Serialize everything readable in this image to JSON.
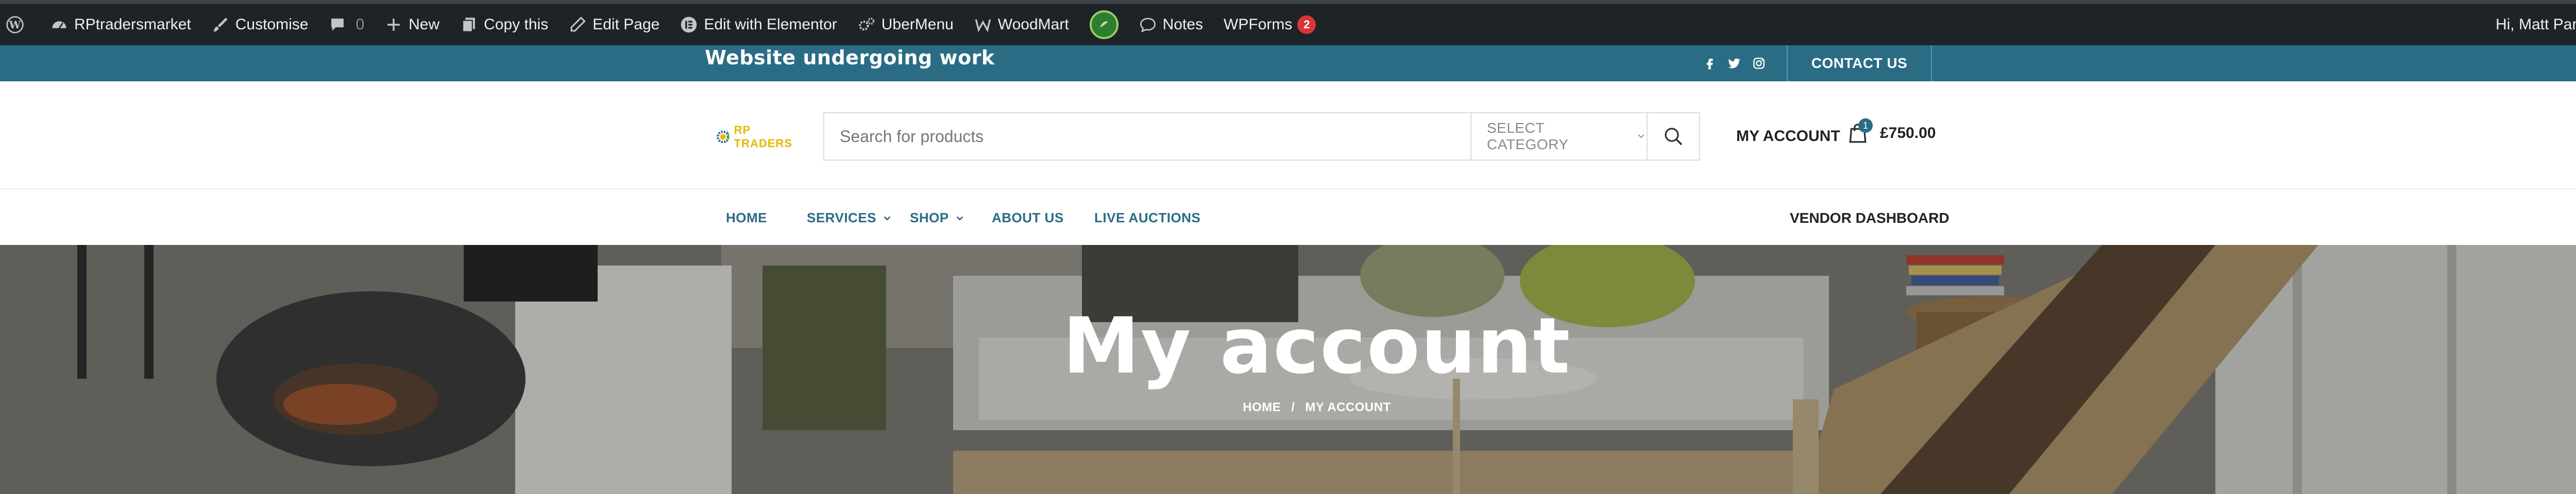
{
  "admin_bar": {
    "site_name": "RPtradersmarket",
    "customise": "Customise",
    "comments_count": "0",
    "new": "New",
    "copy_this": "Copy this",
    "edit_page": "Edit Page",
    "edit_elementor": "Edit with Elementor",
    "ubermenu": "UberMenu",
    "woodmart": "WoodMart",
    "notes": "Notes",
    "wpforms": "WPForms",
    "wpforms_badge": "2",
    "greeting": "Hi, Matt Parker"
  },
  "topbar": {
    "notice": "Website undergoing work",
    "contact": "CONTACT US",
    "bg_color": "#2b6c85"
  },
  "header": {
    "logo_text": "RP TRADERS",
    "search_placeholder": "Search for products",
    "category_label": "SELECT CATEGORY",
    "my_account": "MY ACCOUNT",
    "cart_count": "1",
    "cart_total": "£750.00"
  },
  "nav": {
    "items": [
      {
        "label": "HOME"
      },
      {
        "label": "SERVICES"
      },
      {
        "label": "SHOP"
      },
      {
        "label": "ABOUT US"
      },
      {
        "label": "LIVE AUCTIONS"
      }
    ],
    "vendor_dashboard": "VENDOR DASHBOARD"
  },
  "hero": {
    "title": "My account",
    "breadcrumb_home": "HOME",
    "breadcrumb_separator": "/",
    "breadcrumb_current": "MY ACCOUNT"
  }
}
